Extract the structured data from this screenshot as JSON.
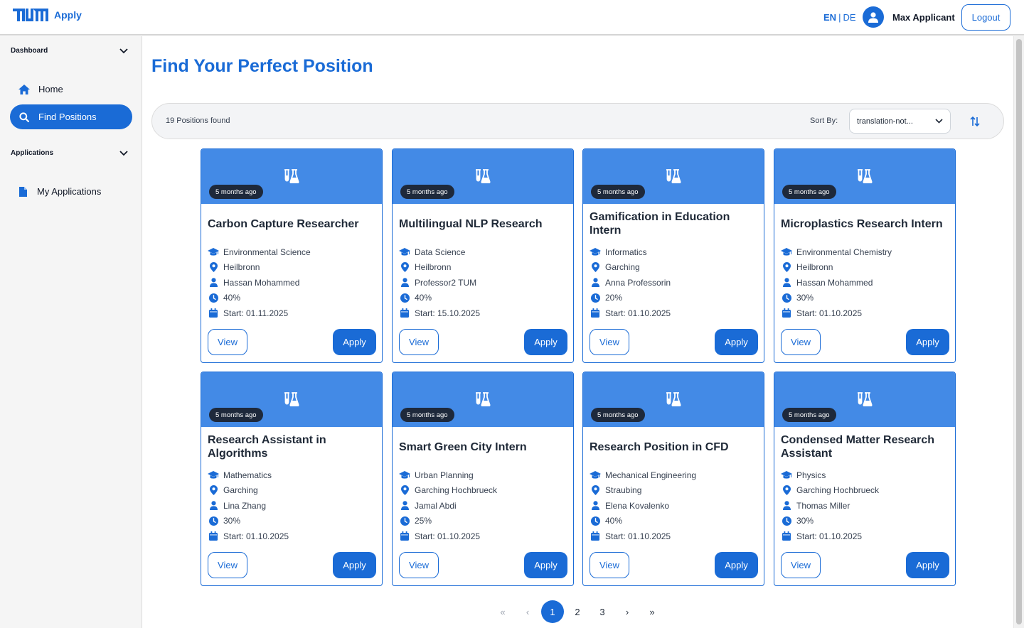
{
  "header": {
    "brand_app": "Apply",
    "lang_active": "EN",
    "lang_sep": "|",
    "lang_other": "DE",
    "username": "Max Applicant",
    "logout_label": "Logout"
  },
  "sidebar": {
    "dashboard_label": "Dashboard",
    "home_label": "Home",
    "find_positions_label": "Find Positions",
    "applications_label": "Applications",
    "my_applications_label": "My Applications"
  },
  "main": {
    "title": "Find Your Perfect Position",
    "count_text": "19 Positions found",
    "sort_label": "Sort By:",
    "sort_value": "translation-not...",
    "view_label": "View",
    "apply_label": "Apply"
  },
  "positions": [
    {
      "badge": "5 months ago",
      "title": "Carbon Capture Researcher",
      "field": "Environmental Science",
      "location": "Heilbronn",
      "supervisor": "Hassan Mohammed",
      "workload": "40%",
      "start": "Start: 01.11.2025"
    },
    {
      "badge": "5 months ago",
      "title": "Multilingual NLP Research",
      "field": "Data Science",
      "location": "Heilbronn",
      "supervisor": "Professor2 TUM",
      "workload": "40%",
      "start": "Start: 15.10.2025"
    },
    {
      "badge": "5 months ago",
      "title": "Gamification in Education Intern",
      "field": "Informatics",
      "location": "Garching",
      "supervisor": "Anna Professorin",
      "workload": "20%",
      "start": "Start: 01.10.2025"
    },
    {
      "badge": "5 months ago",
      "title": "Microplastics Research Intern",
      "field": "Environmental Chemistry",
      "location": "Heilbronn",
      "supervisor": "Hassan Mohammed",
      "workload": "30%",
      "start": "Start: 01.10.2025"
    },
    {
      "badge": "5 months ago",
      "title": "Research Assistant in Algorithms",
      "field": "Mathematics",
      "location": "Garching",
      "supervisor": "Lina Zhang",
      "workload": "30%",
      "start": "Start: 01.10.2025"
    },
    {
      "badge": "5 months ago",
      "title": "Smart Green City Intern",
      "field": "Urban Planning",
      "location": "Garching Hochbrueck",
      "supervisor": "Jamal Abdi",
      "workload": "25%",
      "start": "Start: 01.10.2025"
    },
    {
      "badge": "5 months ago",
      "title": "Research Position in CFD",
      "field": "Mechanical Engineering",
      "location": "Straubing",
      "supervisor": "Elena Kovalenko",
      "workload": "40%",
      "start": "Start: 01.10.2025"
    },
    {
      "badge": "5 months ago",
      "title": "Condensed Matter Research Assistant",
      "field": "Physics",
      "location": "Garching Hochbrueck",
      "supervisor": "Thomas Miller",
      "workload": "30%",
      "start": "Start: 01.10.2025"
    }
  ],
  "pagination": {
    "first": "«",
    "prev": "‹",
    "pages": [
      "1",
      "2",
      "3"
    ],
    "current": "1",
    "next": "›",
    "last": "»"
  },
  "colors": {
    "accent": "#1a6bd6",
    "card_header": "#438ae6",
    "badge": "#1e293b"
  }
}
